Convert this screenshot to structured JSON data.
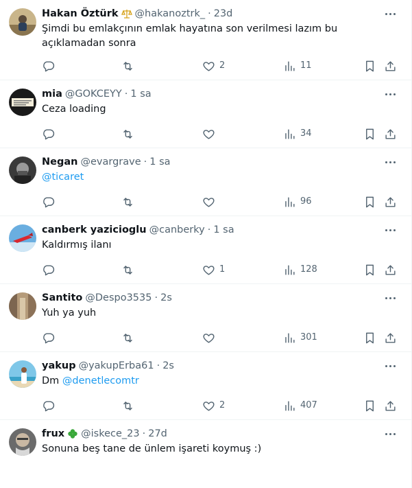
{
  "tweets": [
    {
      "name": "Hakan Öztürk",
      "badge_icon": "scales-icon",
      "handle": "@hakanoztrk_",
      "dot": "·",
      "time": "23d",
      "text": "Şimdi bu emlakçının emlak hayatına son verilmesi lazım bu açıklamadan sonra",
      "replies": "",
      "retweets": "",
      "likes": "2",
      "views": "11"
    },
    {
      "name": "mia",
      "handle": "@GOKCEYY",
      "dot": "·",
      "time": "1 sa",
      "text": "Ceza loading",
      "replies": "",
      "retweets": "",
      "likes": "",
      "views": "34"
    },
    {
      "name": "Negan",
      "handle": "@evargrave",
      "dot": "·",
      "time": "1 sa",
      "text_link": "@ticaret",
      "replies": "",
      "retweets": "",
      "likes": "",
      "views": "96"
    },
    {
      "name": "canberk yazicioglu",
      "handle": "@canberky",
      "dot": "·",
      "time": "1 sa",
      "text": "Kaldırmış ilanı",
      "replies": "",
      "retweets": "",
      "likes": "1",
      "views": "128"
    },
    {
      "name": "Santito",
      "handle": "@Despo3535",
      "dot": "·",
      "time": "2s",
      "text": "Yuh ya yuh",
      "replies": "",
      "retweets": "",
      "likes": "",
      "views": "301"
    },
    {
      "name": "yakup",
      "handle": "@yakupErba61",
      "dot": "·",
      "time": "2s",
      "text": "Dm ",
      "text_link": "@denetlecomtr",
      "replies": "",
      "retweets": "",
      "likes": "2",
      "views": "407"
    },
    {
      "name": "frux",
      "badge_icon": "clover-icon",
      "handle": "@iskece_23",
      "dot": "·",
      "time": "27d",
      "text": "Sonuna beş tane de ünlem işareti koymuş :)"
    }
  ],
  "colors": {
    "text": "#0f1419",
    "secondary": "#536471",
    "link": "#1d9bf0",
    "divider": "#eff3f4",
    "badge_gold": "#d6a21a",
    "clover": "#3aa83a"
  }
}
